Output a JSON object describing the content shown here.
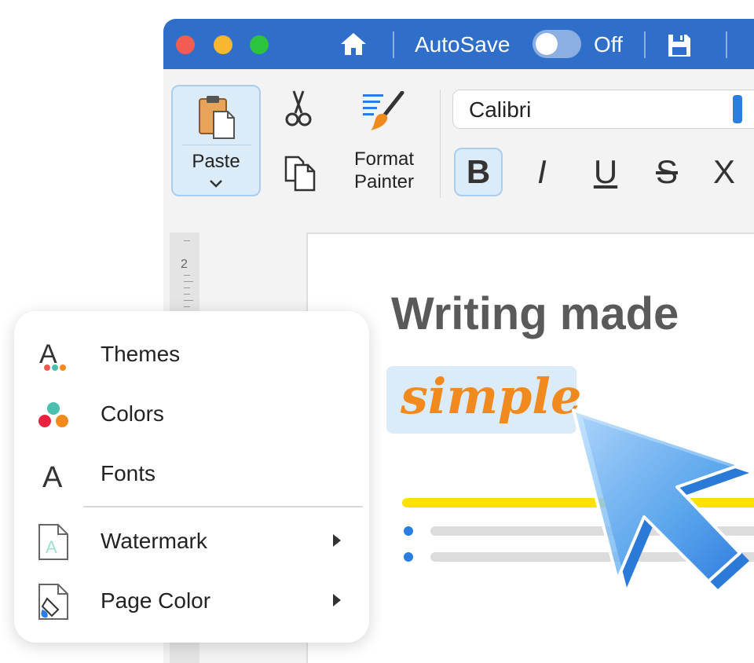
{
  "titlebar": {
    "autosave_label": "AutoSave",
    "autosave_state": "Off",
    "autosave_on": false
  },
  "ribbon": {
    "paste_label": "Paste",
    "format_painter_label": "Format Painter",
    "font_name": "Calibri",
    "format_buttons": {
      "bold": "B",
      "italic": "I",
      "underline": "U",
      "strikethrough": "S",
      "subscript": "X"
    }
  },
  "document": {
    "ruler_number": "2",
    "headline": "Writing made",
    "highlight_word": "simple"
  },
  "design_menu": {
    "items": [
      {
        "label": "Themes",
        "icon": "themes-icon",
        "submenu": false
      },
      {
        "label": "Colors",
        "icon": "colors-icon",
        "submenu": false
      },
      {
        "label": "Fonts",
        "icon": "fonts-icon",
        "submenu": false
      },
      {
        "label": "Watermark",
        "icon": "watermark-icon",
        "submenu": true
      },
      {
        "label": "Page Color",
        "icon": "page-color-icon",
        "submenu": true
      }
    ]
  },
  "colors": {
    "titlebar": "#2f6ec9",
    "accent": "#2b7de0",
    "highlight_bg": "#dcebf8",
    "highlight_text": "#f18a1e",
    "headline_text": "#5a5a5a",
    "yellow_line": "#ffe100"
  }
}
